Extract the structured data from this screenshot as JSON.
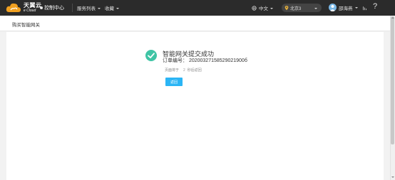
{
  "header": {
    "logo_cn": "天翼云",
    "logo_en": "e Cloud",
    "console_label": "控制中心",
    "menu_services": "服务列表",
    "menu_favorites": "收藏",
    "language": "中文",
    "region": "北京3",
    "username": "邵海燕",
    "help_symbol": "?"
  },
  "page": {
    "title": "购买智能网关"
  },
  "result": {
    "title": "智能网关提交成功",
    "order_label": "订单编号：",
    "order_number": "20200327158529021900б",
    "hint_text": "页面将于",
    "hint_seconds": "2",
    "hint_suffix": "秒后返回",
    "back_button": "返回"
  },
  "icons": {
    "success": "check-circle-icon",
    "bell": "bell-icon",
    "help": "help-icon",
    "region": "location-pin-icon",
    "avatar": "user-avatar-icon"
  },
  "colors": {
    "topbar": "#2b2b2b",
    "success": "#3fc4a5",
    "primary_button": "#2bb5f5"
  }
}
